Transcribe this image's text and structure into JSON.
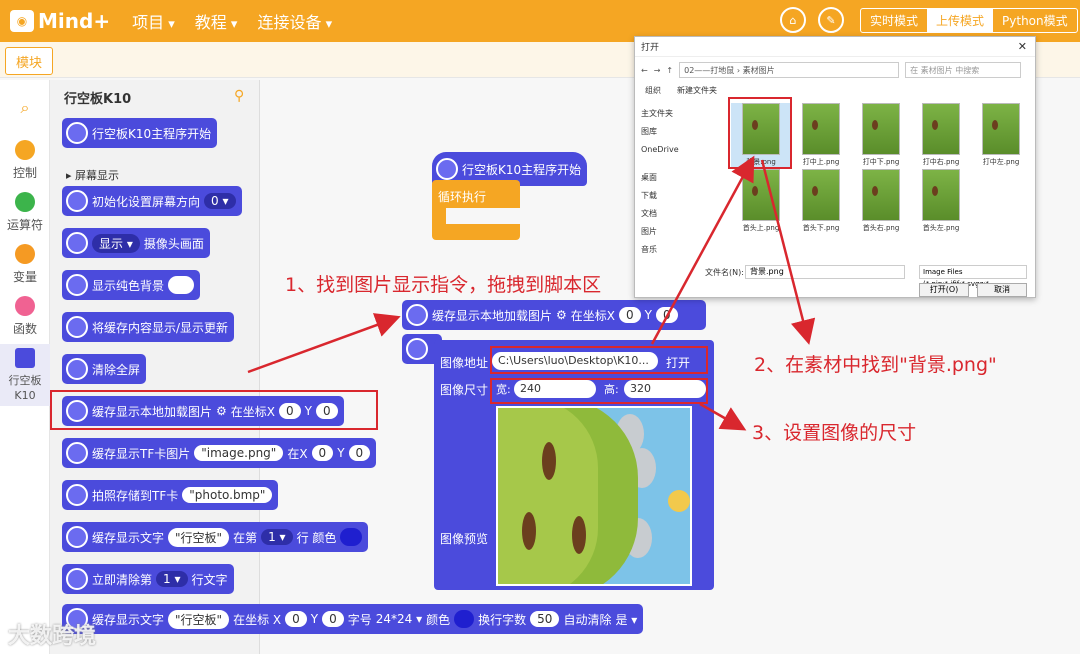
{
  "app": {
    "logo": "Mind+",
    "menu": [
      "项目",
      "教程",
      "连接设备"
    ],
    "modes": [
      "实时模式",
      "上传模式",
      "Python模式"
    ],
    "active_mode": "上传模式"
  },
  "sidebar": {
    "module_tab": "模块",
    "categories": [
      {
        "label": "控制",
        "color": "#f5a623"
      },
      {
        "label": "运算符",
        "color": "#3cb44b"
      },
      {
        "label": "变量",
        "color": "#f59a23"
      },
      {
        "label": "函数",
        "color": "#f06292"
      },
      {
        "label": "行空板K10",
        "color": "#4b4bdc"
      }
    ]
  },
  "palette": {
    "title": "行空板K10",
    "section_screen": "屏幕显示",
    "b_main": "行空板K10主程序开始",
    "b_init": "初始化设置屏幕方向",
    "b_init_v": "0",
    "b_show": "显示",
    "b_show_v": "摄像头画面",
    "b_bg": "显示纯色背景",
    "b_refresh": "将缓存内容显示/显示更新",
    "b_clear": "清除全屏",
    "b_local": "缓存显示本地加载图片",
    "b_at": "在坐标X",
    "b_x": "0",
    "b_y_lbl": "Y",
    "b_y": "0",
    "b_tf": "缓存显示TF卡图片",
    "b_tf_file": "\"image.png\"",
    "b_tf_at": "在X",
    "b_tf_x": "0",
    "b_tf_y": "0",
    "b_photo": "拍照存储到TF卡",
    "b_photo_file": "\"photo.bmp\"",
    "b_text": "缓存显示文字",
    "b_text_v": "\"行空板\"",
    "b_text_row": "在第",
    "b_text_row_v": "1",
    "b_text_row2": "行 颜色",
    "b_clrow": "立即清除第",
    "b_clrow_v": "1",
    "b_clrow2": "行文字",
    "b_text2": "缓存显示文字",
    "b_text2_v": "\"行空板\"",
    "b_text2_at": "在坐标 X",
    "b_text2_x": "0",
    "b_text2_y": "0",
    "b_text2_font": "字号",
    "b_text2_font_v": "24*24",
    "b_text2_color": "颜色",
    "b_text2_wrap": "换行字数",
    "b_text2_wrap_v": "50",
    "b_text2_auto": "自动清除",
    "b_text2_auto_v": "是"
  },
  "canvas": {
    "main": "行空板K10主程序开始",
    "loop": "循环执行",
    "local": "缓存显示本地加载图片",
    "at": "在坐标X",
    "x": "0",
    "y_lbl": "Y",
    "y": "0"
  },
  "popup": {
    "path_label": "图像地址",
    "path_value": "C:\\Users\\luo\\Desktop\\K10...",
    "open_btn": "打开",
    "size_label": "图像尺寸",
    "w_label": "宽:",
    "w": "240",
    "h_label": "高:",
    "h": "320",
    "preview_label": "图像预览"
  },
  "dialog": {
    "title": "打开",
    "path": "02——打地鼠 › 素材图片",
    "search": "在 素材图片 中搜索",
    "organize": "组织",
    "new_folder": "新建文件夹",
    "tree": [
      "主文件夹",
      "图库",
      "OneDrive",
      "桌面",
      "下载",
      "文档",
      "图片",
      "音乐"
    ],
    "files": [
      "背景.png",
      "打中上.png",
      "打中下.png",
      "打中右.png",
      "打中左.png",
      "首头上.png",
      "首头下.png",
      "首头右.png",
      "首头左.png"
    ],
    "fname_label": "文件名(N):",
    "fname": "背景.png",
    "ftype": "Image Files (*.pjp;*.jfif;*.svgz;*",
    "open": "打开(O)",
    "cancel": "取消"
  },
  "annotations": {
    "a1": "1、找到图片显示指令，拖拽到脚本区",
    "a2": "2、在素材中找到\"背景.png\"",
    "a3": "3、设置图像的尺寸"
  },
  "watermark": "大数跨境"
}
